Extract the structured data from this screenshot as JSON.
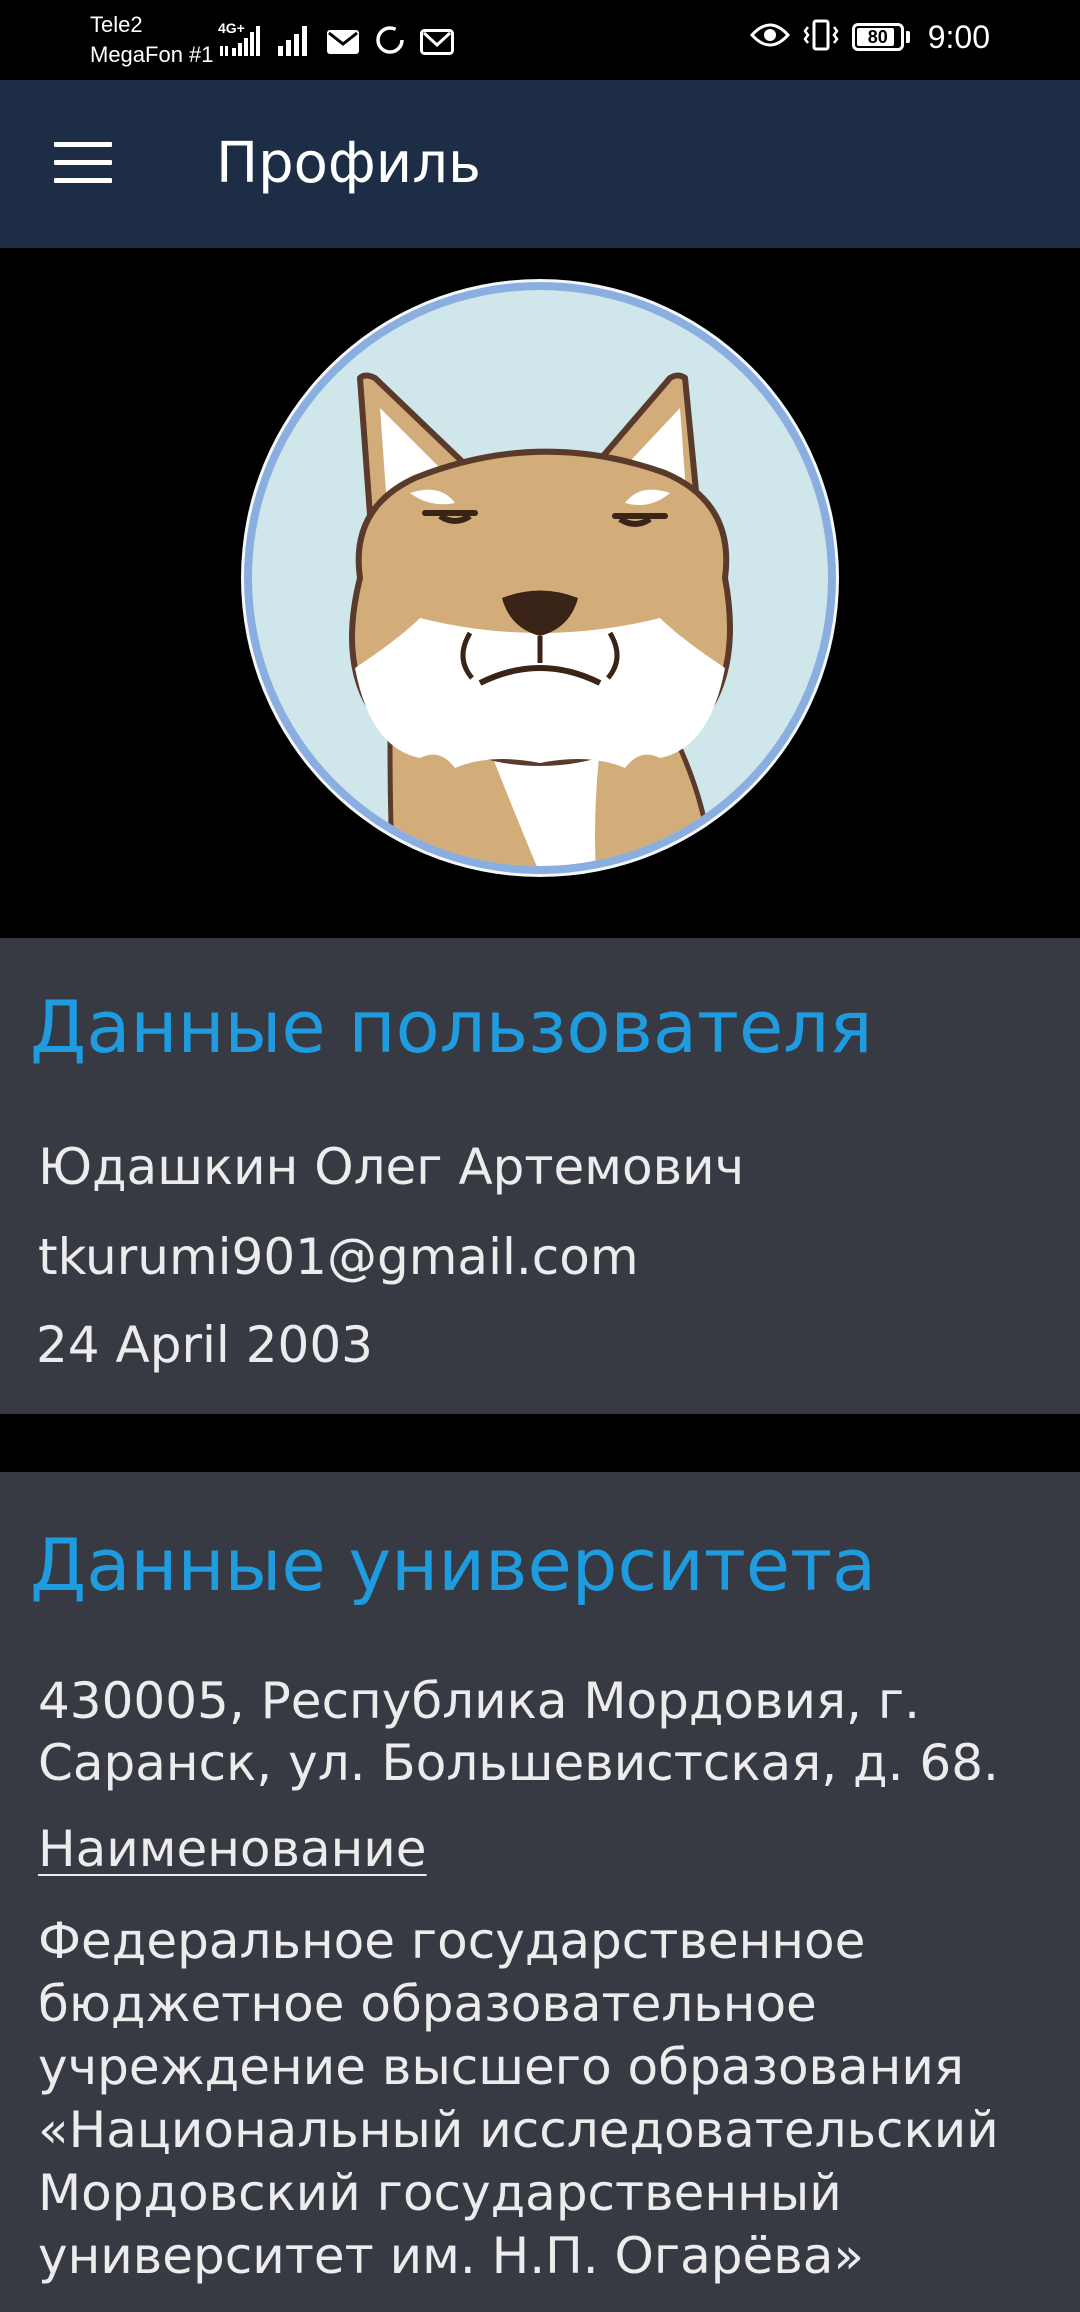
{
  "status_bar": {
    "carrier_1": "Tele2",
    "carrier_2": "MegaFon #1",
    "network_type": "4G+",
    "battery": "80",
    "time": "9:00",
    "icons": [
      "signal-icon",
      "signal-icon",
      "mail-icon",
      "sync-icon",
      "gmail-icon",
      "eye-icon",
      "vibrate-icon",
      "battery-icon"
    ]
  },
  "app_bar": {
    "title": "Профиль",
    "menu_icon": "hamburger-menu-icon"
  },
  "avatar": {
    "icon": "fox-cartoon-avatar",
    "ring_color": "#8aaee0",
    "bg_color": "#cfe7ea"
  },
  "user_card": {
    "title": "Данные пользователя",
    "full_name": "Юдашкин Олег Артемович",
    "email": "tkurumi901@gmail.com",
    "birth_date": "24 April 2003"
  },
  "university_card": {
    "title": "Данные университета",
    "address": "430005, Республика Мордовия, г. Саранск, ул. Большевистская, д. 68.",
    "name_label": "Наименование",
    "name": "Федеральное государственное бюджетное образовательное учреждение высшего образования «Национальный исследовательский Мордовский государственный университет им. Н.П. Огарёва»"
  },
  "colors": {
    "app_bar": "#1c2d45",
    "card_bg": "#373a42",
    "accent": "#1f9be0",
    "page_bg": "#000000"
  }
}
